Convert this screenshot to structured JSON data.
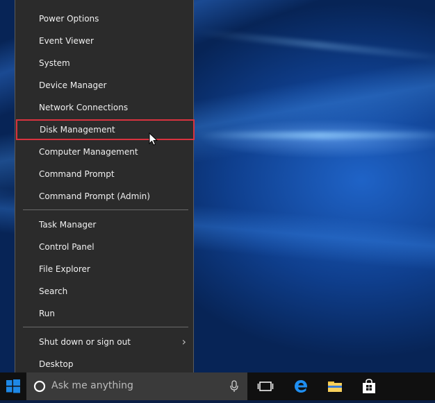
{
  "context_menu": {
    "items_group1": [
      {
        "label": "Power Options"
      },
      {
        "label": "Event Viewer"
      },
      {
        "label": "System"
      },
      {
        "label": "Device Manager"
      },
      {
        "label": "Network Connections"
      },
      {
        "label": "Disk Management",
        "highlighted": true
      },
      {
        "label": "Computer Management"
      },
      {
        "label": "Command Prompt"
      },
      {
        "label": "Command Prompt (Admin)"
      }
    ],
    "items_group2": [
      {
        "label": "Task Manager"
      },
      {
        "label": "Control Panel"
      },
      {
        "label": "File Explorer"
      },
      {
        "label": "Search"
      },
      {
        "label": "Run"
      }
    ],
    "items_group3": [
      {
        "label": "Shut down or sign out",
        "has_submenu": true
      },
      {
        "label": "Desktop"
      }
    ],
    "highlight_color": "#d9333f"
  },
  "taskbar": {
    "search_placeholder": "Ask me anything",
    "icons": [
      "windows-logo-icon",
      "cortana-circle-icon",
      "microphone-icon",
      "task-view-icon",
      "edge-icon",
      "file-explorer-icon",
      "store-icon"
    ]
  }
}
